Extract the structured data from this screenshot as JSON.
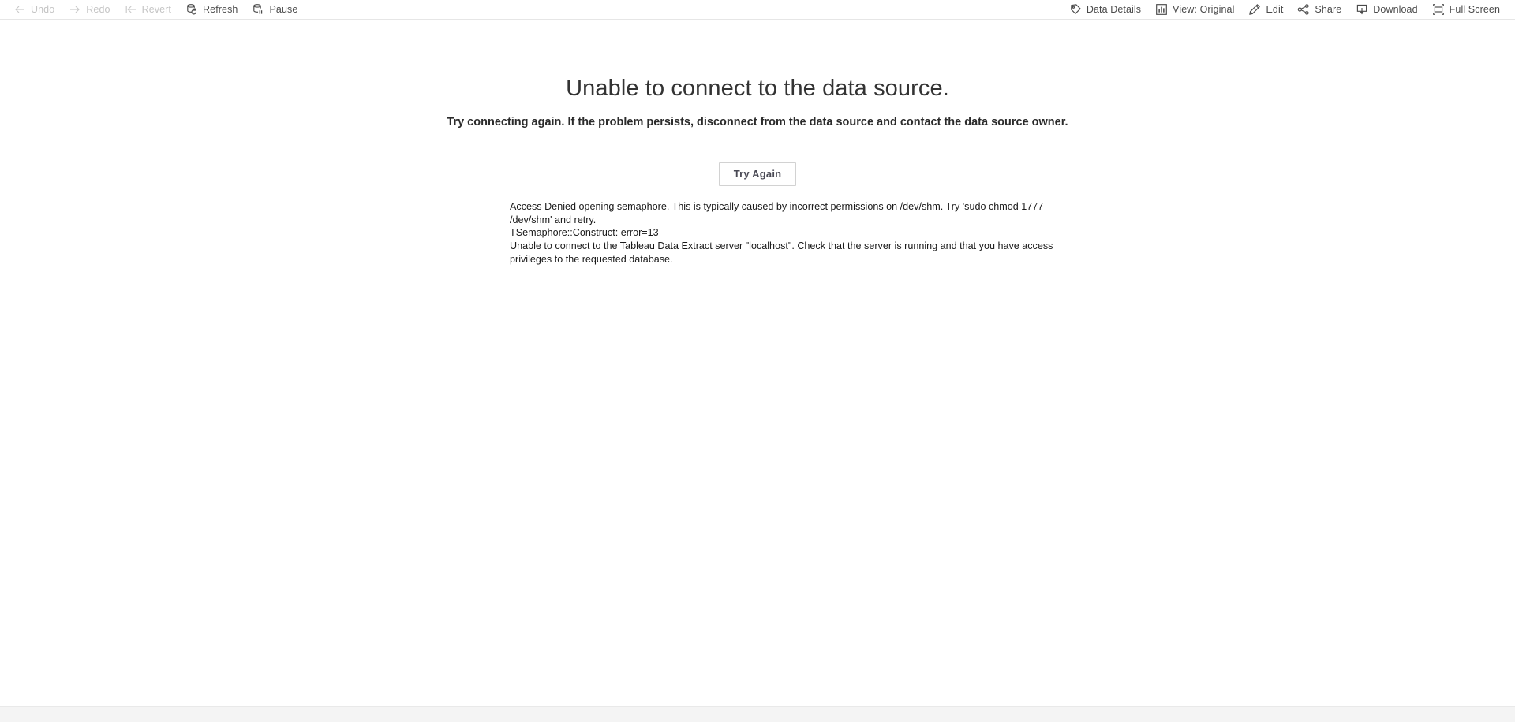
{
  "toolbar": {
    "left_items": [
      {
        "label": "Undo",
        "icon": "undo-arrow-icon",
        "enabled": false
      },
      {
        "label": "Redo",
        "icon": "redo-arrow-icon",
        "enabled": false
      },
      {
        "label": "Revert",
        "icon": "revert-arrow-icon",
        "enabled": false
      },
      {
        "label": "Refresh",
        "icon": "refresh-database-icon",
        "enabled": true
      },
      {
        "label": "Pause",
        "icon": "pause-database-icon",
        "enabled": true
      }
    ],
    "right_items": [
      {
        "label": "Data Details",
        "icon": "tag-icon",
        "enabled": true
      },
      {
        "label": "View: Original",
        "icon": "bar-chart-icon",
        "enabled": true
      },
      {
        "label": "Edit",
        "icon": "pencil-icon",
        "enabled": true
      },
      {
        "label": "Share",
        "icon": "share-nodes-icon",
        "enabled": true
      },
      {
        "label": "Download",
        "icon": "download-icon",
        "enabled": true
      },
      {
        "label": "Full Screen",
        "icon": "fullscreen-icon",
        "enabled": true
      }
    ]
  },
  "error": {
    "title": "Unable to connect to the data source.",
    "subtitle": "Try connecting again. If the problem persists, disconnect from the data source and contact the data source owner.",
    "retry_button_label": "Try Again",
    "details": [
      "Access Denied opening semaphore. This is typically caused by incorrect permissions on /dev/shm. Try 'sudo chmod 1777 /dev/shm' and retry.",
      "TSemaphore::Construct: error=13",
      "Unable to connect to the Tableau Data Extract server \"localhost\". Check that the server is running and that you have access privileges to the requested database."
    ]
  },
  "colors": {
    "page_background": "#ffffff",
    "toolbar_text": "#4a4a4a",
    "toolbar_text_disabled": "#c4c4c4",
    "toolbar_border": "#e6e6e6",
    "title_text": "#333333",
    "details_text": "#1a1a1a",
    "button_border": "#d2d2d2",
    "button_text": "#4a4a55",
    "bottom_bar": "#f4f4f4"
  }
}
